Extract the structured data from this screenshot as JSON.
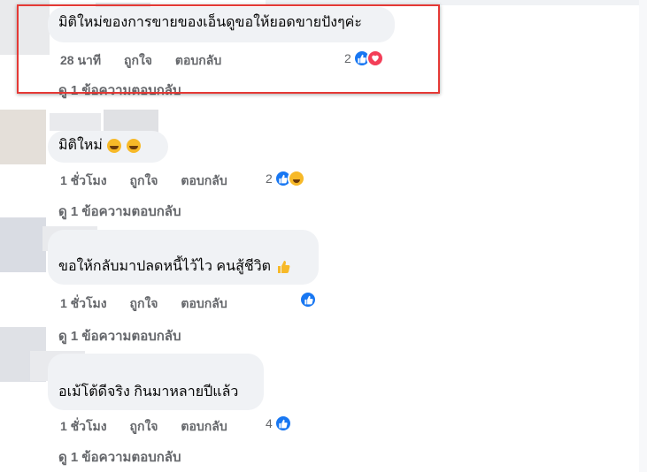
{
  "colors": {
    "highlight": "#e53935",
    "bubble": "#f0f2f5",
    "meta_text": "#65676b",
    "like_blue": "#1877f2",
    "love_red": "#f33e58",
    "haha_yellow": "#f7b928"
  },
  "comments": [
    {
      "text": "มิติใหม่ของการขายของเอ็นดูขอให้ยอดขายปังๆค่ะ",
      "time": "28 นาที",
      "like": "ถูกใจ",
      "reply": "ตอบกลับ",
      "reaction_count": "2",
      "reactions": [
        "like-icon",
        "love-icon"
      ],
      "replies": "ดู 1 ข้อความตอบกลับ"
    },
    {
      "text": "มิติใหม่",
      "emojis": [
        "laughing-emoji",
        "laughing-emoji"
      ],
      "time": "1 ชั่วโมง",
      "like": "ถูกใจ",
      "reply": "ตอบกลับ",
      "reaction_count": "2",
      "reactions": [
        "like-icon",
        "haha-icon"
      ],
      "replies": "ดู 1 ข้อความตอบกลับ"
    },
    {
      "text": "ขอให้กลับมาปลดหนี้ไว้ไว คนสู้ชีวิต",
      "emojis": [
        "thumbs-up-emoji"
      ],
      "time": "1 ชั่วโมง",
      "like": "ถูกใจ",
      "reply": "ตอบกลับ",
      "reaction_count": "",
      "reactions": [
        "like-icon"
      ],
      "replies": "ดู 1 ข้อความตอบกลับ"
    },
    {
      "text": "อเม้โต้ดีจริง กินมาหลายปีแล้ว",
      "time": "1 ชั่วโมง",
      "like": "ถูกใจ",
      "reply": "ตอบกลับ",
      "reaction_count": "4",
      "reactions": [
        "like-icon"
      ],
      "replies": "ดู 1 ข้อความตอบกลับ"
    }
  ]
}
